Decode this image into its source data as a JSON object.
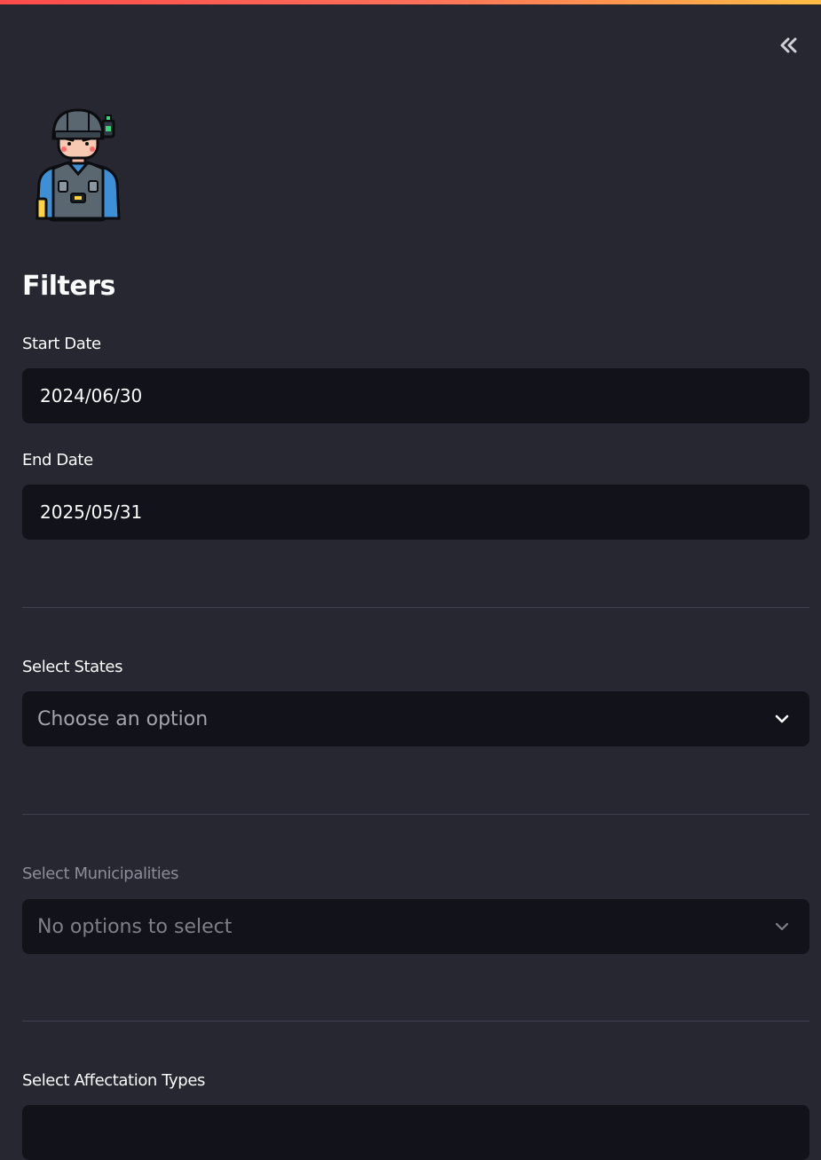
{
  "sidebar": {
    "collapse_icon": "double-chevron-left-icon",
    "avatar_icon": "soldier-avatar-icon",
    "title": "Filters",
    "start_date": {
      "label": "Start Date",
      "value": "2024/06/30"
    },
    "end_date": {
      "label": "End Date",
      "value": "2025/05/31"
    },
    "states": {
      "label": "Select States",
      "placeholder": "Choose an option"
    },
    "municipalities": {
      "label": "Select Municipalities",
      "placeholder": "No options to select"
    },
    "affectation_types": {
      "label": "Select Affectation Types"
    }
  },
  "colors": {
    "background": "#262730",
    "input_bg": "#12131a",
    "accent_gradient_start": "#ff4b4b",
    "accent_gradient_end": "#ffbd45",
    "text": "#fafafa",
    "muted_text": "#8b8d98"
  }
}
